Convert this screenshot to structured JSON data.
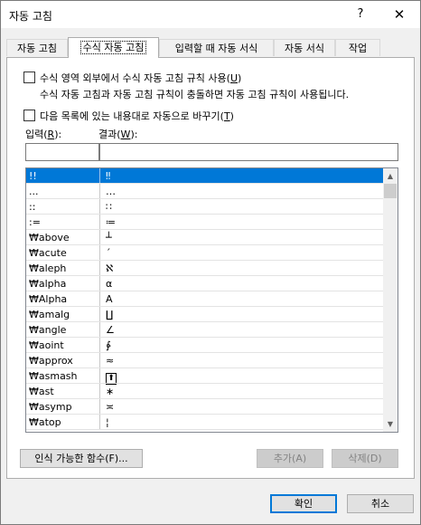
{
  "window": {
    "title": "자동 고침",
    "help": "?",
    "close": "✕"
  },
  "tabs": [
    {
      "label": "자동 고침"
    },
    {
      "label": "수식 자동 고침"
    },
    {
      "label": "입력할 때 자동 서식"
    },
    {
      "label": "자동 서식"
    },
    {
      "label": "작업"
    }
  ],
  "options": {
    "use_outside": {
      "text": "수식 영역 외부에서 수식 자동 고침 규칙 사용(",
      "key": "U",
      "end": ")"
    },
    "conflict_note": "수식 자동 고침과 자동 고침 규칙이 충돌하면 자동 고침 규칙이 사용됩니다.",
    "replace": {
      "text": "다음 목록에 있는 내용대로 자동으로 바꾸기(",
      "key": "T",
      "end": ")"
    }
  },
  "fields": {
    "input_label": {
      "text": "입력(",
      "key": "R",
      "end": "):"
    },
    "result_label": {
      "text": "결과(",
      "key": "W",
      "end": "):"
    },
    "input_value": "",
    "result_value": ""
  },
  "list": {
    "rows": [
      {
        "input": "!!",
        "output": "‼"
      },
      {
        "input": "...",
        "output": "…"
      },
      {
        "input": "::",
        "output": "∷"
      },
      {
        "input": ":=",
        "output": "≔"
      },
      {
        "input": "₩above",
        "output": "┴"
      },
      {
        "input": "₩acute",
        "output": "´"
      },
      {
        "input": "₩aleph",
        "output": "ℵ"
      },
      {
        "input": "₩alpha",
        "output": "α"
      },
      {
        "input": "₩Alpha",
        "output": "Α"
      },
      {
        "input": "₩amalg",
        "output": "∐"
      },
      {
        "input": "₩angle",
        "output": "∠"
      },
      {
        "input": "₩aoint",
        "output": "∳"
      },
      {
        "input": "₩approx",
        "output": "≈"
      },
      {
        "input": "₩asmash",
        "output": "⬆"
      },
      {
        "input": "₩ast",
        "output": "∗"
      },
      {
        "input": "₩asymp",
        "output": "≍"
      },
      {
        "input": "₩atop",
        "output": "¦"
      }
    ]
  },
  "buttons": {
    "functions": "인식 가능한 함수(F)...",
    "add": "추가(A)",
    "delete": "삭제(D)",
    "ok": "확인",
    "cancel": "취소"
  }
}
